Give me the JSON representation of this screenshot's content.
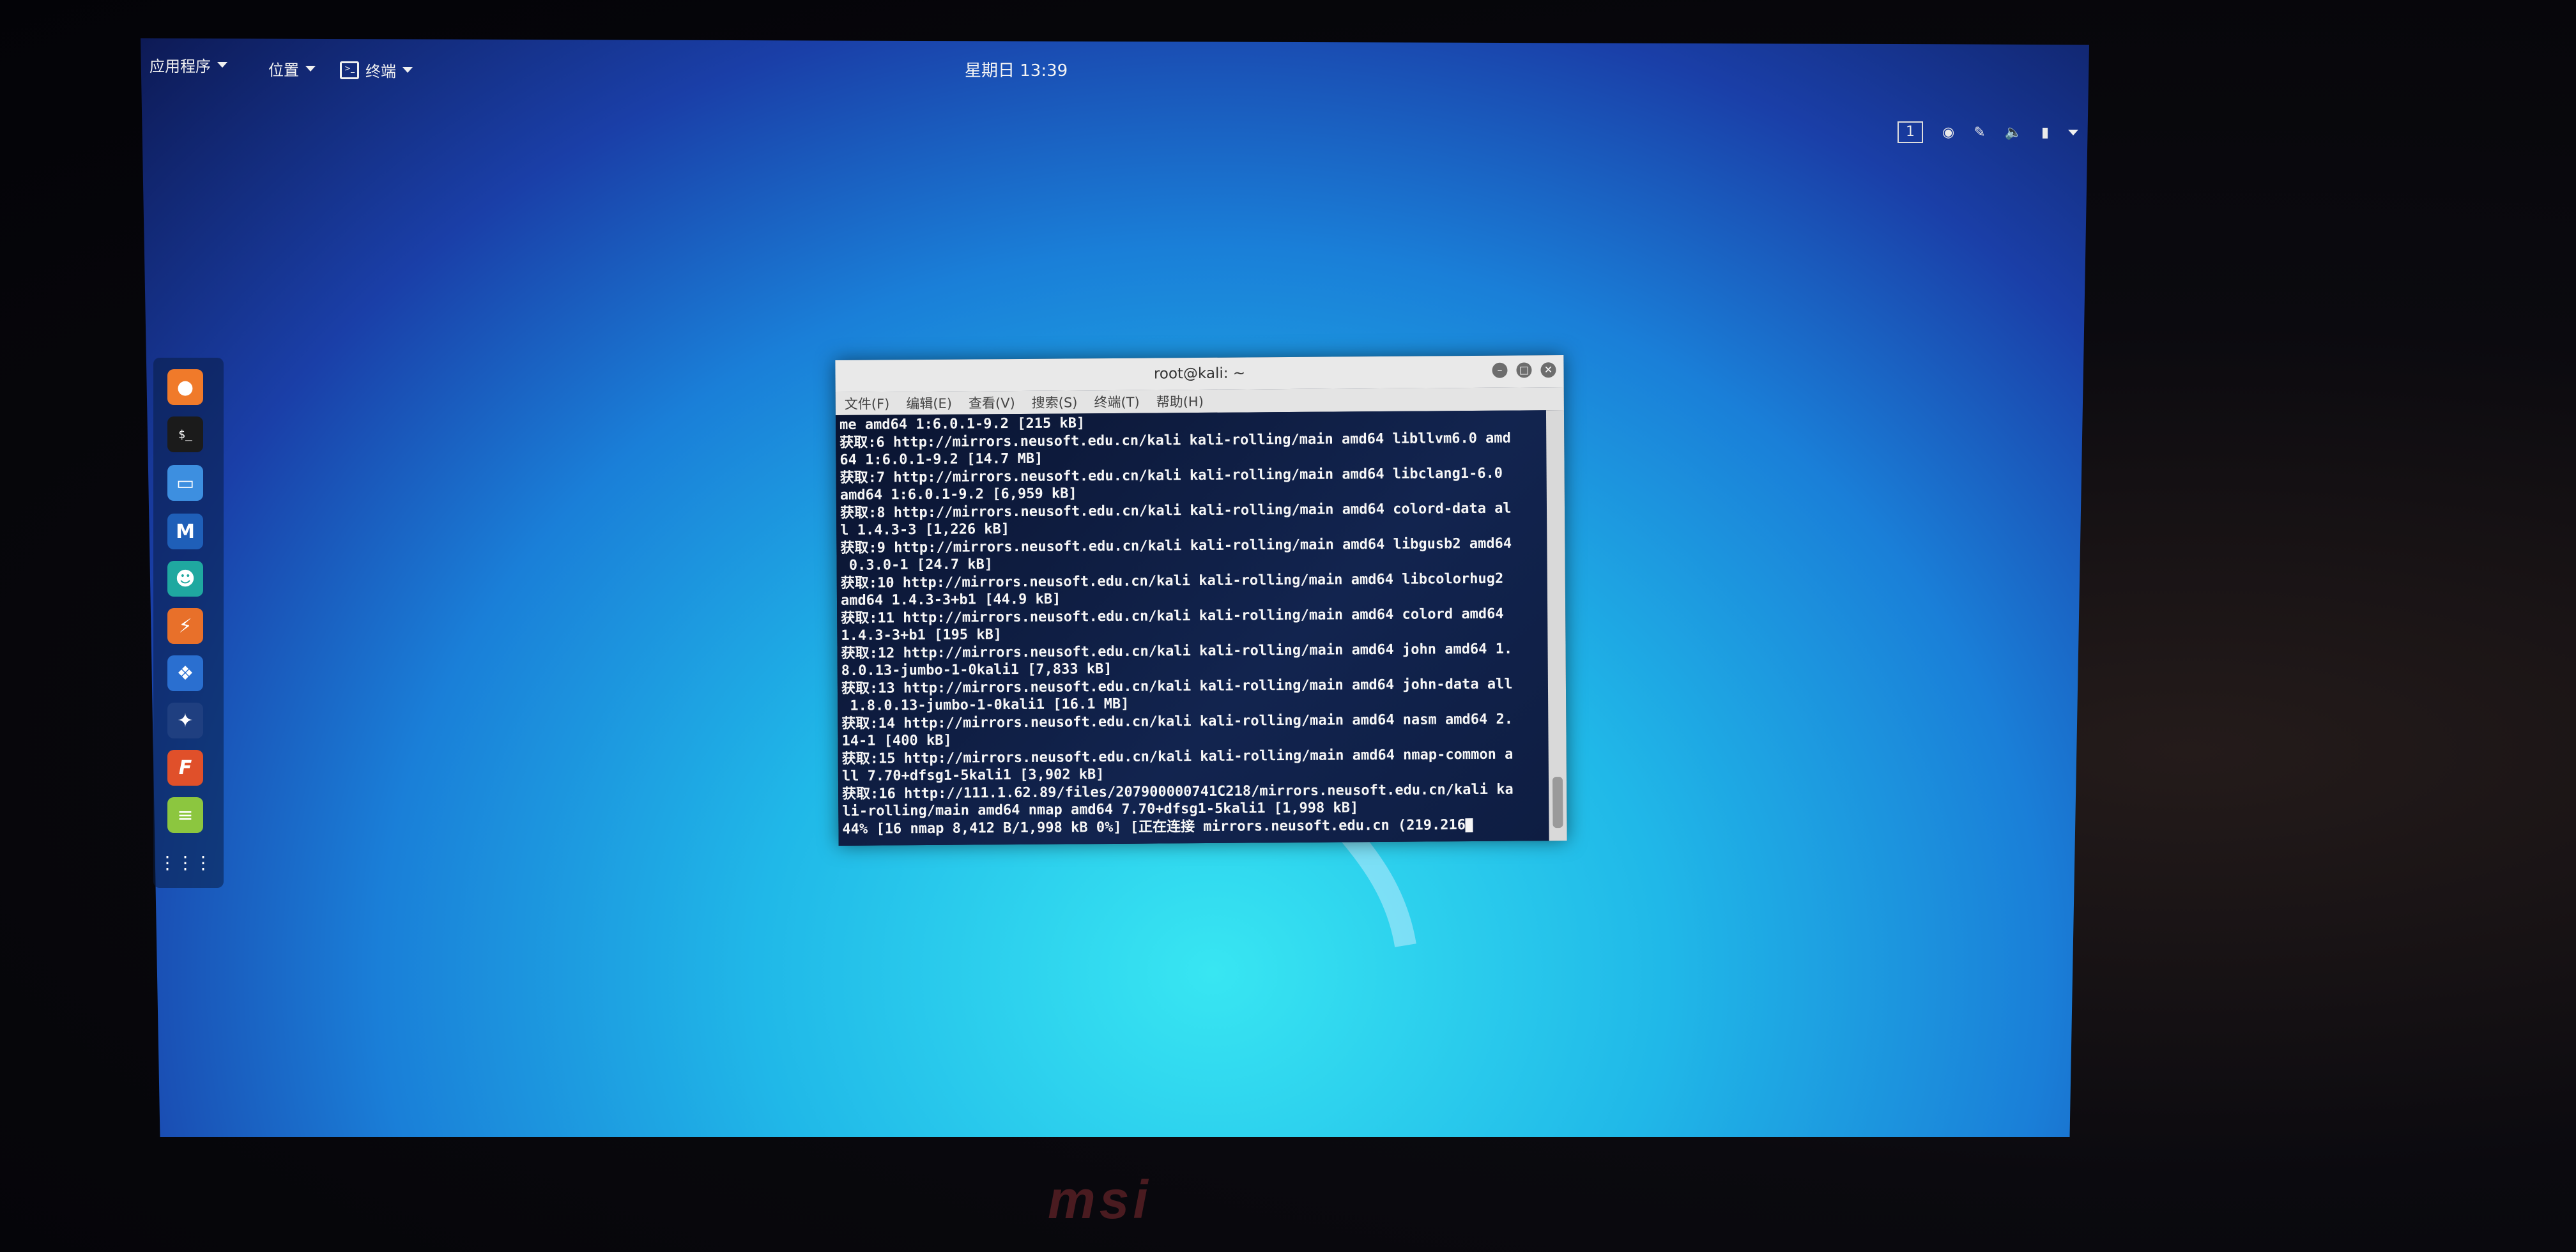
{
  "topbar": {
    "applications": "应用程序",
    "places": "位置",
    "terminal_app": "终端",
    "clock": "星期日 13:39",
    "workspace": "1"
  },
  "dock": {
    "items": [
      {
        "name": "firefox-icon"
      },
      {
        "name": "terminal-icon"
      },
      {
        "name": "files-icon"
      },
      {
        "name": "metasploit-icon"
      },
      {
        "name": "armitage-icon"
      },
      {
        "name": "burpsuite-icon"
      },
      {
        "name": "beef-icon"
      },
      {
        "name": "faraday-icon"
      },
      {
        "name": "leafpad-icon"
      },
      {
        "name": "notes-icon"
      },
      {
        "name": "show-apps-icon"
      }
    ]
  },
  "terminal": {
    "title": "root@kali: ~",
    "menu": [
      "文件(F)",
      "编辑(E)",
      "查看(V)",
      "搜索(S)",
      "终端(T)",
      "帮助(H)"
    ],
    "lines": [
      "me amd64 1:6.0.1-9.2 [215 kB]",
      "获取:6 http://mirrors.neusoft.edu.cn/kali kali-rolling/main amd64 libllvm6.0 amd",
      "64 1:6.0.1-9.2 [14.7 MB]",
      "获取:7 http://mirrors.neusoft.edu.cn/kali kali-rolling/main amd64 libclang1-6.0",
      "amd64 1:6.0.1-9.2 [6,959 kB]",
      "获取:8 http://mirrors.neusoft.edu.cn/kali kali-rolling/main amd64 colord-data al",
      "l 1.4.3-3 [1,226 kB]",
      "获取:9 http://mirrors.neusoft.edu.cn/kali kali-rolling/main amd64 libgusb2 amd64",
      " 0.3.0-1 [24.7 kB]",
      "获取:10 http://mirrors.neusoft.edu.cn/kali kali-rolling/main amd64 libcolorhug2",
      "amd64 1.4.3-3+b1 [44.9 kB]",
      "获取:11 http://mirrors.neusoft.edu.cn/kali kali-rolling/main amd64 colord amd64",
      "1.4.3-3+b1 [195 kB]",
      "获取:12 http://mirrors.neusoft.edu.cn/kali kali-rolling/main amd64 john amd64 1.",
      "8.0.13-jumbo-1-0kali1 [7,833 kB]",
      "获取:13 http://mirrors.neusoft.edu.cn/kali kali-rolling/main amd64 john-data all",
      " 1.8.0.13-jumbo-1-0kali1 [16.1 MB]",
      "获取:14 http://mirrors.neusoft.edu.cn/kali kali-rolling/main amd64 nasm amd64 2.",
      "14-1 [400 kB]",
      "获取:15 http://mirrors.neusoft.edu.cn/kali kali-rolling/main amd64 nmap-common a",
      "ll 7.70+dfsg1-5kali1 [3,902 kB]",
      "获取:16 http://111.1.62.89/files/207900000741C218/mirrors.neusoft.edu.cn/kali ka",
      "li-rolling/main amd64 nmap amd64 7.70+dfsg1-5kali1 [1,998 kB]",
      "44% [16 nmap 8,412 B/1,998 kB 0%] [正在连接 mirrors.neusoft.edu.cn (219.216"
    ]
  },
  "laptop": {
    "brand": "msi"
  },
  "colors": {
    "desktop": "#1a9be0",
    "terminal_bg": "#0b1633",
    "titlebar": "#e9e9e9"
  }
}
